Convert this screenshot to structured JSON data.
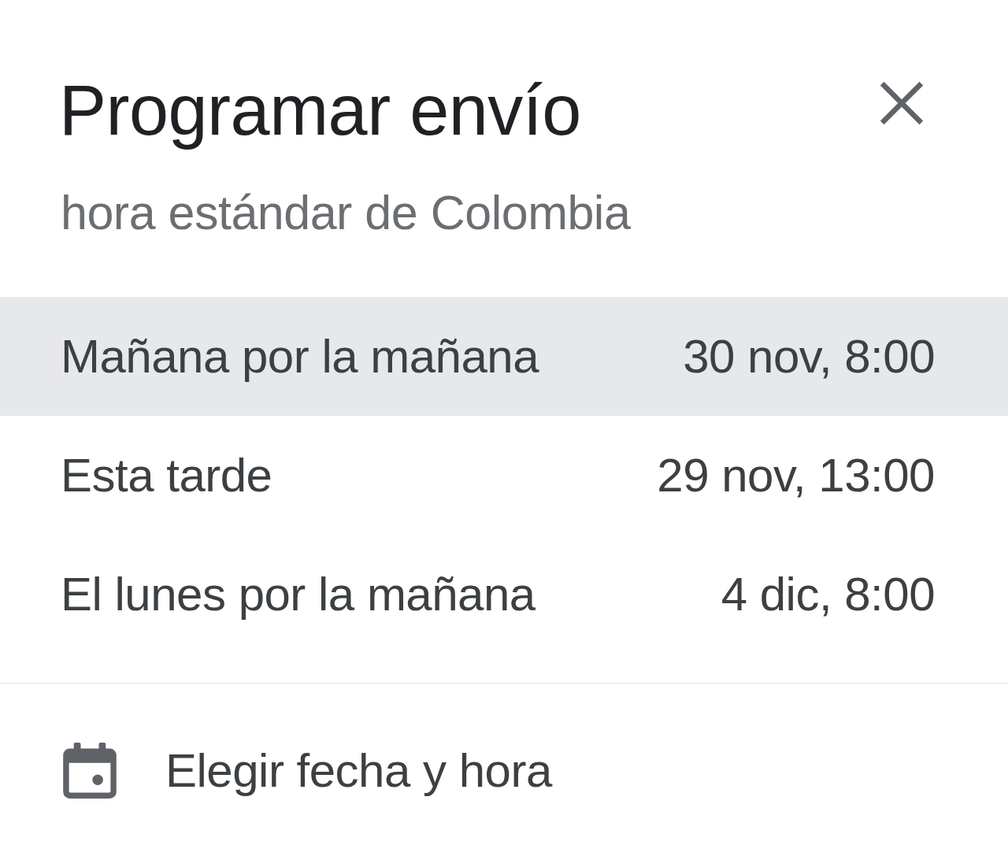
{
  "dialog": {
    "title": "Programar envío",
    "subtitle": "hora estándar de Colombia"
  },
  "options": [
    {
      "label": "Mañana por la mañana",
      "time": "30 nov, 8:00",
      "selected": true
    },
    {
      "label": "Esta tarde",
      "time": "29 nov, 13:00",
      "selected": false
    },
    {
      "label": "El lunes por la mañana",
      "time": "4 dic, 8:00",
      "selected": false
    }
  ],
  "custom_option": {
    "label": "Elegir fecha y hora"
  }
}
